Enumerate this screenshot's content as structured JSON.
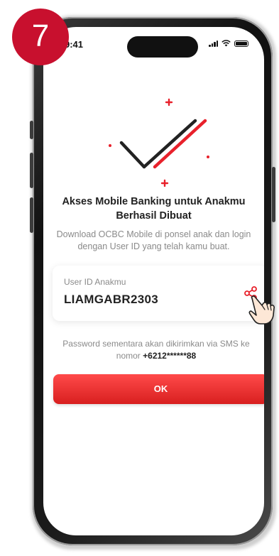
{
  "step_badge": "7",
  "status_bar": {
    "time": "9:41"
  },
  "screen": {
    "title_line1": "Akses Mobile Banking untuk Anakmu",
    "title_line2": "Berhasil Dibuat",
    "subtitle_line1": "Download OCBC Mobile di ponsel anak dan login",
    "subtitle_line2": "dengan User ID yang telah kamu buat.",
    "user_id_card": {
      "label": "User ID Anakmu",
      "value": "LIAMGABR2303",
      "share_icon": "share-icon"
    },
    "password_hint_line1": "Password sementara akan dikirimkan via SMS ke",
    "password_hint_prefix": "nomor ",
    "password_hint_phone": "+6212******88",
    "ok_button": "OK"
  },
  "colors": {
    "accent": "#e8212b",
    "badge": "#c8102e",
    "text_dark": "#222222",
    "text_muted": "#8a8a8a"
  }
}
